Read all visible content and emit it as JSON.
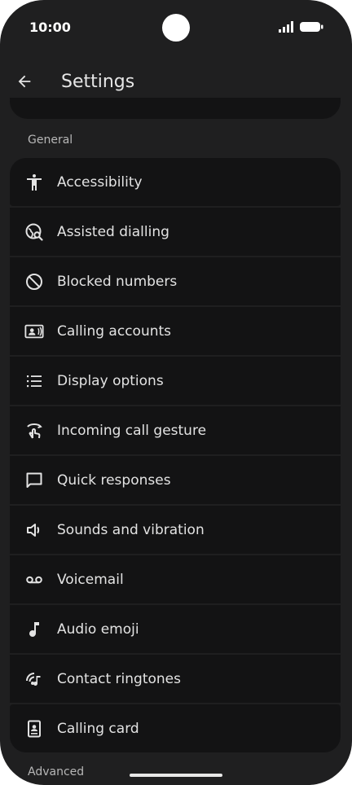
{
  "status_bar": {
    "time": "10:00"
  },
  "app_bar": {
    "title": "Settings",
    "back_icon": "arrow-left-icon"
  },
  "sections": {
    "general": "General",
    "advanced": "Advanced"
  },
  "settings_items": [
    {
      "label": "Accessibility",
      "icon": "accessibility-icon"
    },
    {
      "label": "Assisted dialling",
      "icon": "assisted-dialling-icon"
    },
    {
      "label": "Blocked numbers",
      "icon": "blocked-icon"
    },
    {
      "label": "Calling accounts",
      "icon": "calling-accounts-icon"
    },
    {
      "label": "Display options",
      "icon": "list-icon"
    },
    {
      "label": "Incoming call gesture",
      "icon": "gesture-icon"
    },
    {
      "label": "Quick responses",
      "icon": "message-icon"
    },
    {
      "label": "Sounds and vibration",
      "icon": "speaker-icon"
    },
    {
      "label": "Voicemail",
      "icon": "voicemail-icon"
    },
    {
      "label": "Audio emoji",
      "icon": "music-note-icon"
    },
    {
      "label": "Contact ringtones",
      "icon": "contact-ringtones-icon"
    },
    {
      "label": "Calling card",
      "icon": "calling-card-icon"
    }
  ],
  "colors": {
    "background": "#1f1f20",
    "card": "#131314",
    "text": "#e3e3e3",
    "section_label": "#b7b7b7"
  }
}
